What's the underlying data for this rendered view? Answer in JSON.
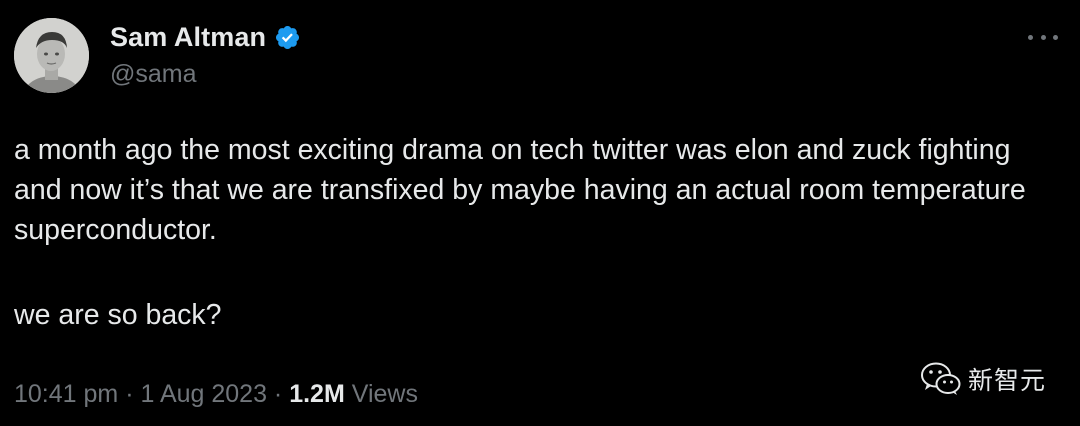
{
  "author": {
    "display_name": "Sam Altman",
    "handle": "@sama",
    "verified": true,
    "verified_color": "#1d9bf0"
  },
  "tweet": {
    "paragraphs": [
      "a month ago the most exciting drama on tech twitter was elon and zuck fighting and now it’s that we are transfixed by maybe having an actual room temperature superconductor.",
      "we are so back?"
    ]
  },
  "meta": {
    "time": "10:41 pm",
    "separator": " · ",
    "date": "1 Aug 2023",
    "views_count": "1.2M",
    "views_label": "Views"
  },
  "icons": {
    "more": "more-horizontal-icon",
    "verified": "verified-badge-icon"
  },
  "watermark": {
    "text": "新智元"
  },
  "colors": {
    "background": "#000000",
    "primary_text": "#e7e9ea",
    "secondary_text": "#71767b"
  }
}
